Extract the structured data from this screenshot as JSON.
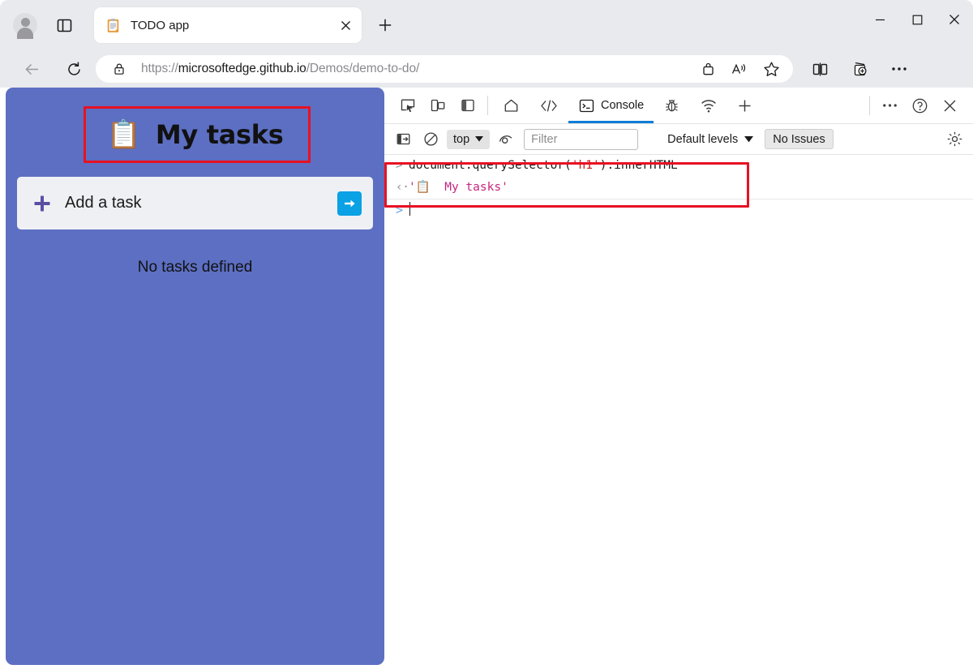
{
  "browser": {
    "profile_icon": "avatar-icon",
    "tab_actions_icon": "tab-actions-icon",
    "tab": {
      "favicon": "clipboard-favicon",
      "title": "TODO app",
      "close_icon": "close-icon"
    },
    "new_tab_icon": "plus-icon",
    "window_controls": {
      "minimize": "minimize-icon",
      "maximize": "maximize-icon",
      "close": "close-icon"
    },
    "nav": {
      "back_icon": "back-arrow-icon",
      "refresh_icon": "refresh-icon"
    },
    "omnibox": {
      "lock_icon": "lock-icon",
      "url_prefix": "https://",
      "url_host": "microsoftedge.github.io",
      "url_path": "/Demos/demo-to-do/",
      "full_url": "https://microsoftedge.github.io/Demos/demo-to-do/",
      "shopping_icon": "shopping-bag-icon",
      "read_aloud_icon": "read-aloud-icon",
      "favorite_icon": "star-icon"
    },
    "toolbar": {
      "split_screen_icon": "split-screen-icon",
      "collections_icon": "collections-icon",
      "settings_icon": "ellipsis-icon"
    }
  },
  "page": {
    "title_emoji": "📋",
    "title_text": "My tasks",
    "add_task_placeholder": "Add a task",
    "add_task_value": "",
    "add_icon": "plus-icon",
    "submit_icon": "arrow-right-icon",
    "empty_message": "No tasks defined",
    "background_color": "#5c6fc2",
    "submit_button_color": "#0aa1e5"
  },
  "devtools": {
    "tool_icons": {
      "inspect": "inspect-element-icon",
      "device_emulation": "device-emulation-icon",
      "dock_side": "dock-side-icon"
    },
    "tabs": [
      {
        "label": "",
        "icon": "home-icon",
        "active": false
      },
      {
        "label": "",
        "icon": "elements-code-icon",
        "active": false
      },
      {
        "label": "Console",
        "icon": "console-icon",
        "active": true
      },
      {
        "label": "",
        "icon": "bug-icon",
        "active": false
      },
      {
        "label": "",
        "icon": "network-wifi-icon",
        "active": false
      },
      {
        "label": "",
        "icon": "plus-icon",
        "active": false
      }
    ],
    "active_tab": "Console",
    "active_tab_underline_color": "#0f7cd6",
    "right_icons": {
      "more": "ellipsis-icon",
      "help": "question-mark-icon",
      "close": "close-icon"
    },
    "filterbar": {
      "sidebar_icon": "console-sidebar-icon",
      "clear_icon": "clear-console-icon",
      "context": "top",
      "context_chevron": "chevron-down-icon",
      "live_expression_icon": "eye-icon",
      "filter_placeholder": "Filter",
      "filter_value": "",
      "levels_label": "Default levels",
      "levels_chevron": "chevron-down-icon",
      "issues_label": "No Issues",
      "settings_icon": "gear-icon"
    },
    "console": {
      "entries": [
        {
          "type": "input",
          "prompt": ">",
          "code_before": "document.querySelector(",
          "code_string": "'h1'",
          "code_after": ").innerHTML"
        },
        {
          "type": "output",
          "prompt": "‹·",
          "value": "'📋  My tasks'",
          "color": "#c5257e"
        },
        {
          "type": "prompt",
          "prompt": ">",
          "value": ""
        }
      ]
    }
  },
  "annotations": [
    {
      "name": "title-highlight",
      "color": "#e81123"
    },
    {
      "name": "console-result-highlight",
      "color": "#e81123"
    }
  ]
}
